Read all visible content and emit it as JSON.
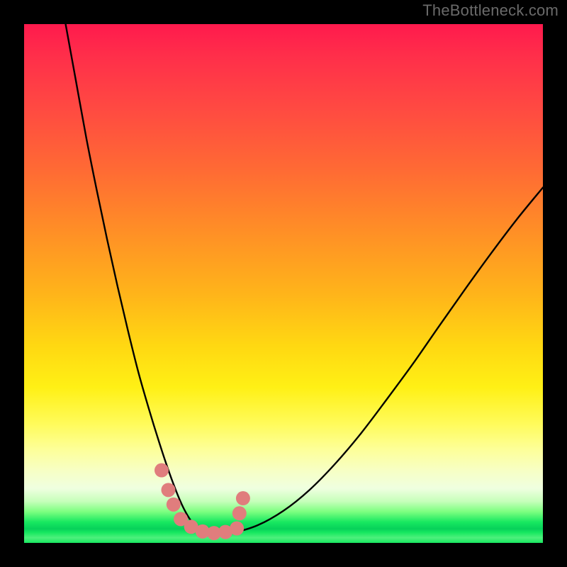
{
  "watermark": "TheBottleneck.com",
  "chart_data": {
    "type": "line",
    "title": "",
    "xlabel": "",
    "ylabel": "",
    "xlim": [
      0,
      100
    ],
    "ylim": [
      0,
      100
    ],
    "grid": false,
    "legend": false,
    "background_gradient": {
      "top_color": "#ff1a4d",
      "mid_color": "#ffe515",
      "bottom_color": "#17e860"
    },
    "series": [
      {
        "name": "bottleneck-curve",
        "color": "#000000",
        "x": [
          8,
          10,
          12,
          14,
          16,
          18,
          20,
          22,
          24,
          26,
          28,
          30,
          31.5,
          33,
          35,
          37,
          40,
          45,
          50,
          55,
          60,
          65,
          70,
          75,
          80,
          85,
          90,
          95,
          100
        ],
        "y": [
          100,
          89,
          78,
          68,
          58.5,
          49.5,
          41,
          33,
          26,
          19.5,
          13.5,
          8.3,
          5.3,
          3.3,
          2.1,
          1.7,
          1.9,
          3.4,
          6.2,
          10.2,
          15.3,
          21.2,
          27.8,
          34.6,
          41.8,
          48.9,
          55.8,
          62.4,
          68.5
        ]
      }
    ],
    "highlight_markers": {
      "color": "#e07d7d",
      "radius_px": 10,
      "points": [
        {
          "x": 26.5,
          "y": 14
        },
        {
          "x": 27.8,
          "y": 10.2
        },
        {
          "x": 28.8,
          "y": 7.4
        },
        {
          "x": 30.2,
          "y": 4.6
        },
        {
          "x": 32.2,
          "y": 3.1
        },
        {
          "x": 34.4,
          "y": 2.2
        },
        {
          "x": 36.6,
          "y": 1.9
        },
        {
          "x": 38.8,
          "y": 2.1
        },
        {
          "x": 41.0,
          "y": 2.8
        },
        {
          "x": 41.5,
          "y": 5.7
        },
        {
          "x": 42.2,
          "y": 8.6
        }
      ]
    }
  }
}
